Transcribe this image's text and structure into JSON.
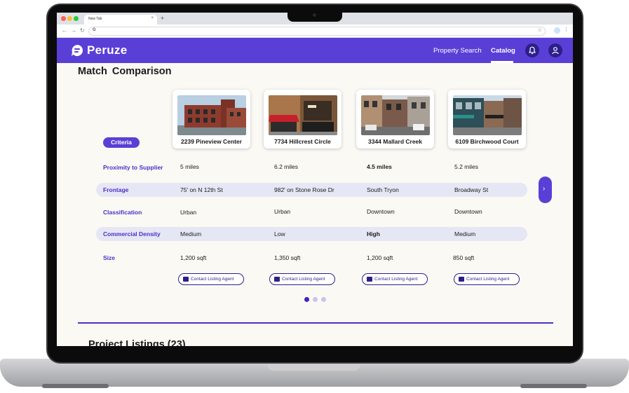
{
  "browser": {
    "tab_title": "New Tab",
    "tab_close": "×",
    "new_tab": "+",
    "omnibox_prefix": "G"
  },
  "app": {
    "brand": "Peruze",
    "nav": {
      "property_search": "Property Search",
      "catalog": "Catalog"
    },
    "colors": {
      "accent": "#5a3fd6",
      "accent_dark": "#2d1f8a",
      "band": "#e6e7f4"
    }
  },
  "comparison": {
    "title": "Match  Comparison",
    "criteria_label": "Criteria",
    "properties": [
      {
        "name": "2239 Pineview Center"
      },
      {
        "name": "7734 Hillcrest Circle"
      },
      {
        "name": "3344 Mallard Creek"
      },
      {
        "name": "6109 Birchwood Court"
      }
    ],
    "rows": [
      {
        "label": "Proximity to Supplier",
        "values": [
          "5 miles",
          "6.2 miles",
          "4.5 miles",
          "5.2 miles"
        ]
      },
      {
        "label": "Frontage",
        "values": [
          "75' on N 12th St",
          "982' on Stone Rose Dr",
          "South Tryon",
          "Broadway St"
        ]
      },
      {
        "label": "Classification",
        "values": [
          "Urban",
          "Urban",
          "Downtown",
          "Downtown"
        ]
      },
      {
        "label": "Commercial Density",
        "values": [
          "Medium",
          "Low",
          "High",
          "Medium"
        ]
      },
      {
        "label": "Size",
        "values": [
          "1,200 sqft",
          "1,350 sqft",
          "1,200 sqft",
          "850 sqft"
        ]
      }
    ],
    "contact_label": "Contact Listing Agent",
    "pagination": {
      "pages": 3,
      "current": 1
    }
  },
  "listings": {
    "title": "Project Listings (23)"
  }
}
